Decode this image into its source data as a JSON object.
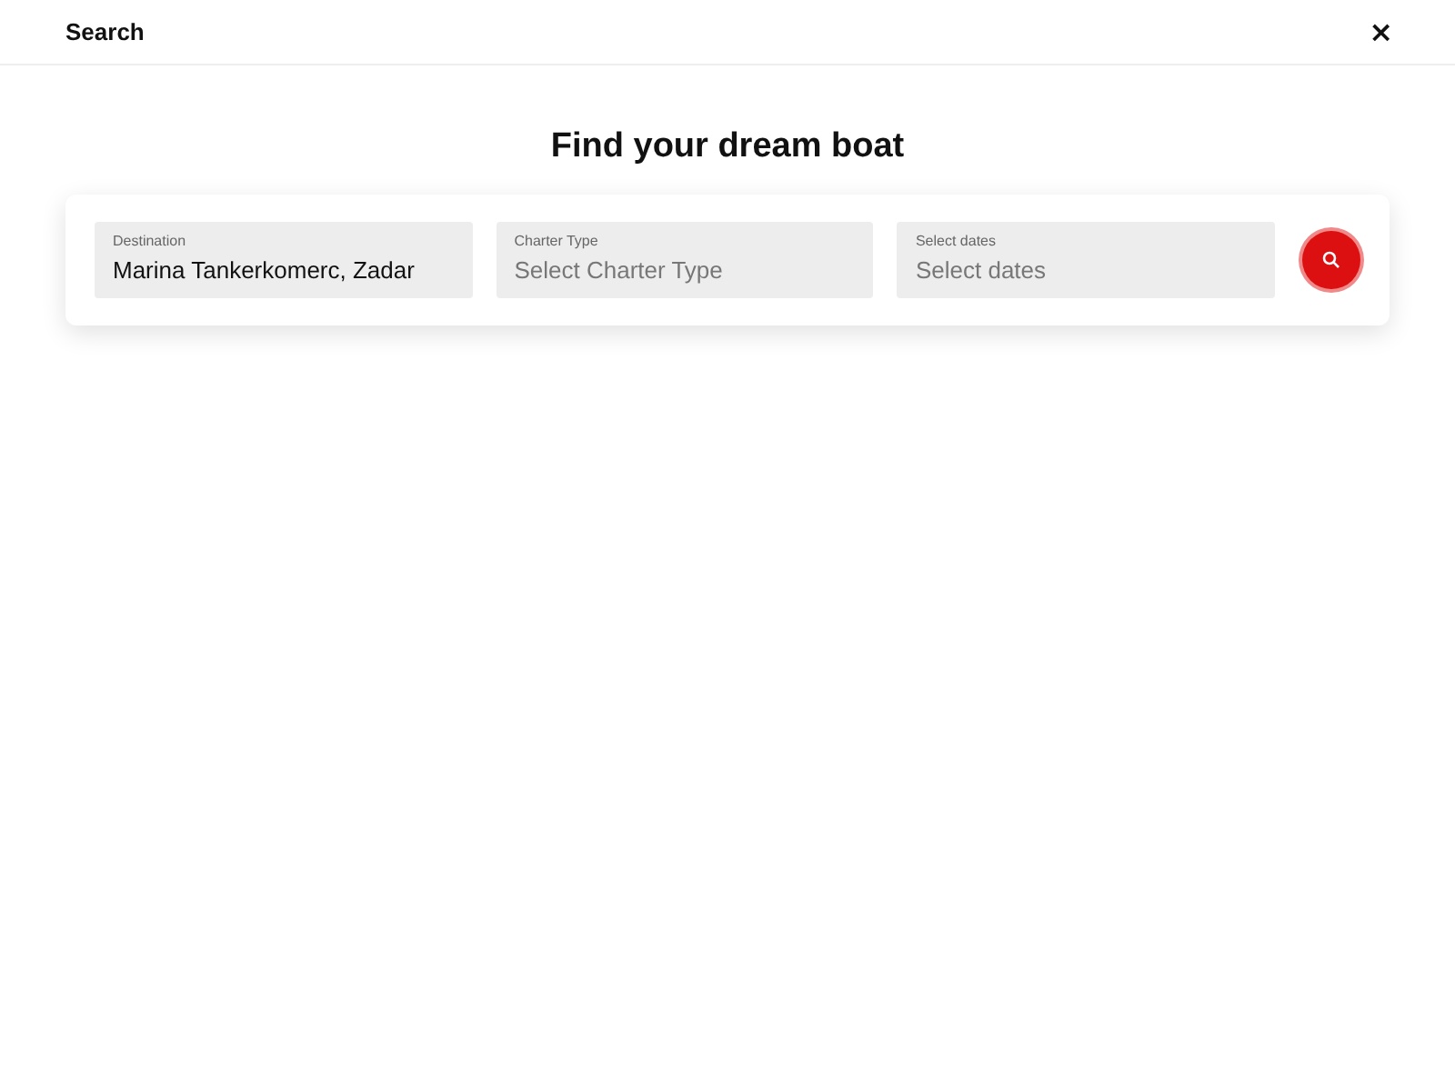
{
  "header": {
    "title": "Search",
    "close": "×"
  },
  "heading": "Find your dream boat",
  "fields": [
    {
      "label": "Destination",
      "value": "Marina Tankerkomerc, Zadar"
    },
    {
      "label": "Charter Type",
      "placeholder": "Select Charter Type"
    },
    {
      "label": "Select dates",
      "placeholder": "Select dates"
    }
  ]
}
